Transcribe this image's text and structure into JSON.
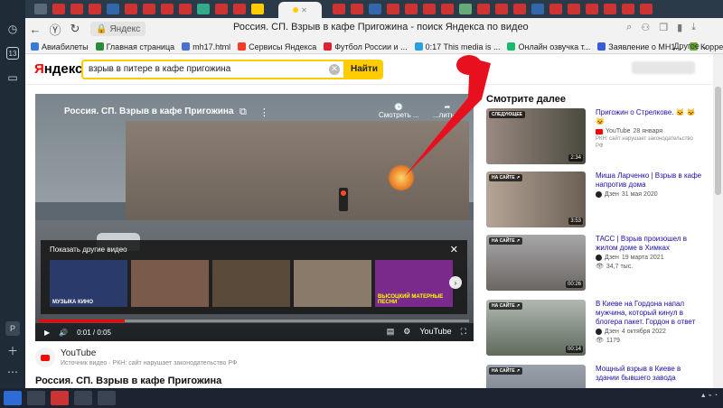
{
  "browser": {
    "window_title": "Россия. СП. Взрыв в кафе Пригожина - поиск Яндекса по видео",
    "url_label": "Яндекс",
    "bookmarks": [
      {
        "label": "Авиабилеты",
        "color": "#3a7bd5"
      },
      {
        "label": "Главная страница",
        "color": "#2a8c3a"
      },
      {
        "label": "mh17.html",
        "color": "#4a6fd0"
      },
      {
        "label": "Сервисы Яндекса",
        "color": "#f03b2b"
      },
      {
        "label": "Футбол России и ...",
        "color": "#d23"
      },
      {
        "label": "0:17 This media is ...",
        "color": "#2aa0e0"
      },
      {
        "label": "Онлайн озвучка т...",
        "color": "#1cb870"
      },
      {
        "label": "Заявление о МН1...",
        "color": "#3a5ad8"
      },
      {
        "label": "Корреспон...",
        "color": "#6a3"
      }
    ],
    "bookmarks_more": "Другое"
  },
  "yandex": {
    "logo_prefix": "Я",
    "logo_rest": "ндекс",
    "search_value": "взрыв в питере в кафе пригожина",
    "search_button": "Найти"
  },
  "video": {
    "title": "Россия. СП. Взрыв в кафе Пригожина",
    "watch_later": "Смотреть ...",
    "share": "...литься",
    "other_panel_title": "Показать другие видео",
    "thumbs": [
      {
        "label": "МУЗЫКА  КИНО",
        "color": "#2a3a6a"
      },
      {
        "label": "",
        "color": "#7a5a4a"
      },
      {
        "label": "",
        "color": "#5a4a3a"
      },
      {
        "label": "",
        "color": "#8a7a6a"
      },
      {
        "label": "ВЫСОЦКИЙ МАТЕРНЫЕ ПЕСНИ",
        "color": "#7a2a8a"
      },
      {
        "label": "",
        "color": "#3a2a2a"
      }
    ],
    "time": "0:01 / 0:05",
    "progress_fraction": 0.2,
    "brand": "YouTube"
  },
  "source": {
    "name": "YouTube",
    "note": "Источник видео · РКН: сайт нарушает законодательство РФ"
  },
  "below_title": "Россия. СП. Взрыв в кафе Пригожина",
  "sidebar": {
    "heading": "Смотрите далее",
    "items": [
      {
        "tag": "СЛЕДУЮЩЕЕ",
        "duration": "2:34",
        "title": "Пригожин о Стрелкове. 🐱 🐱 🐱",
        "source": "YouTube",
        "date": "28 января",
        "note": "РКН: сайт нарушает законодательство РФ",
        "thumb": "#6a5a52",
        "kind": "yt"
      },
      {
        "tag": "НА САЙТЕ ↗",
        "duration": "3:53",
        "title": "Миша Ларченко | Взрыв в кафе напротив дома",
        "source": "Дзен",
        "date": "31 мая 2020",
        "note": "",
        "thumb": "#7a6a62",
        "kind": "dz"
      },
      {
        "tag": "НА САЙТЕ ↗",
        "duration": "00:26",
        "title": "ТАСС | Взрыв произошел в жилом доме в Химках",
        "source": "Дзен",
        "date": "19 марта 2021",
        "note": "34,7 тыс.",
        "thumb": "#8a7a74",
        "kind": "dz"
      },
      {
        "tag": "НА САЙТЕ ↗",
        "duration": "00:14",
        "title": "В Киеве на Гордона напал мужчина, который кинул в блогера пакет. Гордон в ответ",
        "source": "Дзен",
        "date": "4 октября 2022",
        "note": "1179",
        "thumb": "#6d7a6a",
        "kind": "dz"
      },
      {
        "tag": "НА САЙТЕ ↗",
        "duration": "",
        "title": "Мощный взрыв в Киеве в здании бывшего завода",
        "source": "",
        "date": "",
        "note": "",
        "thumb": "#7a7f88",
        "kind": ""
      }
    ]
  },
  "colors": {
    "accent_yellow": "#ffcc00",
    "annotation_red": "#e8101e"
  }
}
